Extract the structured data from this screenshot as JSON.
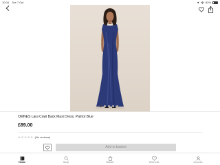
{
  "status_bar": {
    "time": "10:04",
    "date": "Tue 7 Oct",
    "battery": "82%"
  },
  "product": {
    "title": "OMNES Lara Cowl Back Maxi Dress, Patriot Blue",
    "price": "£89.00",
    "stars": "☆☆☆☆☆",
    "reviews": "(No reviews)",
    "dress_color": "#2c3a78",
    "image_count": 5,
    "active_image": 1
  },
  "actions": {
    "add_to_basket": "Add to basket"
  },
  "tabs": [
    {
      "label": "Home",
      "icon": "home-icon",
      "active": true
    },
    {
      "label": "Shop",
      "icon": "search-icon",
      "active": false
    },
    {
      "label": "Basket",
      "icon": "basket-icon",
      "active": false
    },
    {
      "label": "Wish List",
      "icon": "heart-icon",
      "active": false
    },
    {
      "label": "Account",
      "icon": "account-icon",
      "active": false
    }
  ]
}
